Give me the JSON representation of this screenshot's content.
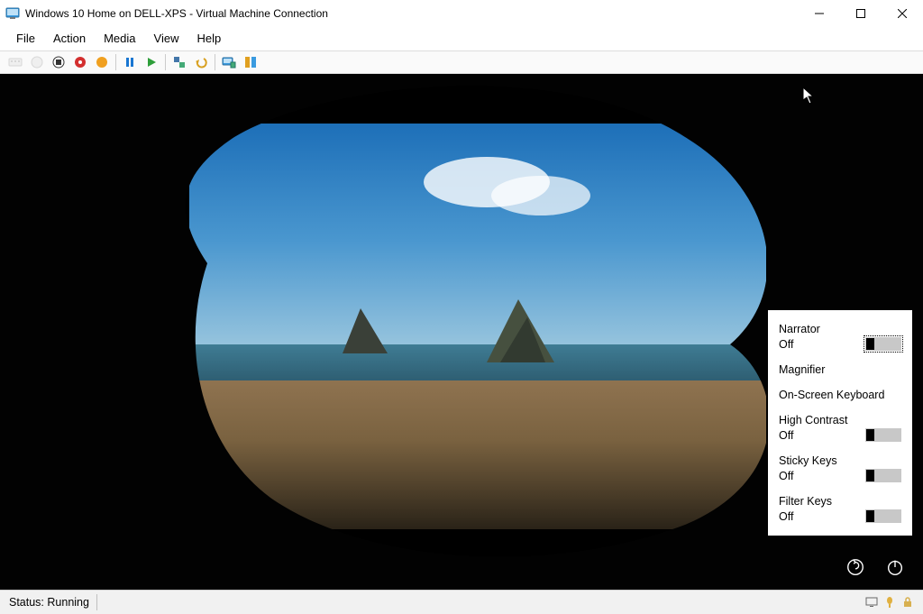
{
  "titlebar": {
    "title": "Windows 10 Home on DELL-XPS - Virtual Machine Connection"
  },
  "menu": {
    "file": "File",
    "action": "Action",
    "media": "Media",
    "view": "View",
    "help": "Help"
  },
  "toolbar_icons": {
    "ctrl_alt_del": "ctrl-alt-del-icon",
    "power_off": "turn-off-icon",
    "shutdown": "shutdown-icon",
    "save": "save-icon",
    "reset": "reset-icon",
    "pause": "pause-icon",
    "start": "start-icon",
    "checkpoint": "checkpoint-icon",
    "revert": "revert-icon",
    "enhanced": "enhanced-session-icon",
    "share": "share-icon"
  },
  "panel": {
    "narrator": {
      "label": "Narrator",
      "state": "Off"
    },
    "magnifier": {
      "label": "Magnifier"
    },
    "osk": {
      "label": "On-Screen Keyboard"
    },
    "high_contrast": {
      "label": "High Contrast",
      "state": "Off"
    },
    "sticky_keys": {
      "label": "Sticky Keys",
      "state": "Off"
    },
    "filter_keys": {
      "label": "Filter Keys",
      "state": "Off"
    }
  },
  "status": {
    "text": "Status: Running"
  }
}
